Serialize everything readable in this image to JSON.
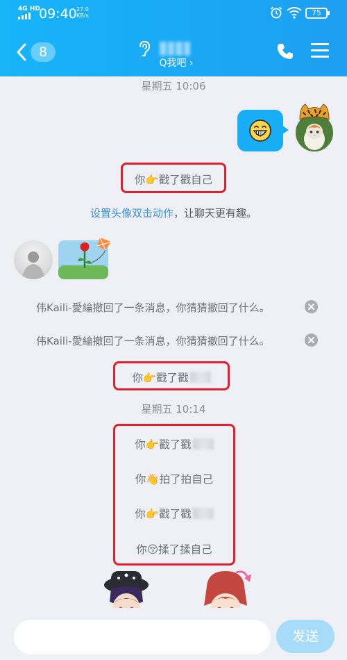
{
  "status_bar": {
    "network": "4G HD",
    "time": "09:40",
    "speed_value": "27.0",
    "speed_unit": "KB/s",
    "battery": "75"
  },
  "header": {
    "unread_count": "8",
    "subtitle": "Q我吧 ›",
    "background_color": "#1aa8f5"
  },
  "chat": {
    "time_1": "星期五 10:06",
    "hint_link": "设置头像双击动作",
    "hint_rest": "，让聊天更有趣。",
    "time_2": "星期五 10:14"
  },
  "highlighted_groups": [
    {
      "lines": [
        {
          "text": "你👉戳了戳自己"
        }
      ]
    },
    {
      "lines": [
        {
          "text": "你👉戳了戳"
        }
      ]
    },
    {
      "lines": [
        {
          "text": "你👉戳了戳"
        },
        {
          "text": "你👋拍了拍自己"
        },
        {
          "text": "你👉戳了戳"
        },
        {
          "text": "你😚揉了揉自己"
        }
      ]
    }
  ],
  "recalls": [
    {
      "text": "伟Kaili-愛綸撤回了一条消息，你猜猜撤回了什么。"
    },
    {
      "text": "伟Kaili-愛綸撤回了一条消息，你猜猜撤回了什么。"
    }
  ],
  "input": {
    "placeholder": "",
    "send_label": "发送"
  },
  "colors": {
    "highlight_border": "#e0202e",
    "link": "#3b8fd6",
    "bubble": "#17aef5"
  }
}
